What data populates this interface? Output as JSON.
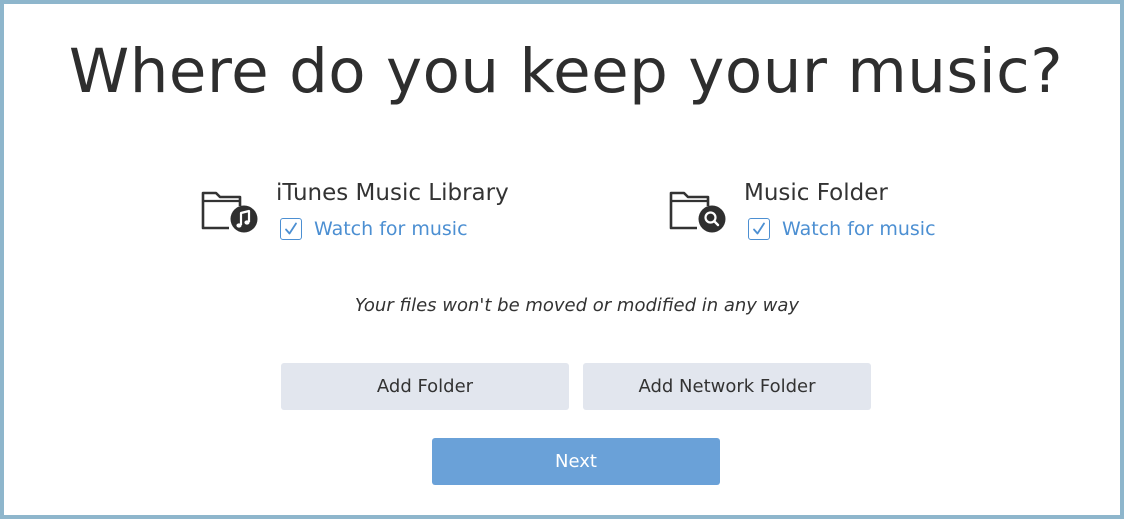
{
  "title": "Where do you keep your music?",
  "sources": [
    {
      "name": "iTunes Music Library",
      "icon": "folder-music-note-icon",
      "watch_label": "Watch for music",
      "watch_checked": true
    },
    {
      "name": "Music Folder",
      "icon": "folder-search-icon",
      "watch_label": "Watch for music",
      "watch_checked": true
    }
  ],
  "note": "Your files won't be moved or modified in any way",
  "buttons": {
    "add_folder": "Add Folder",
    "add_network_folder": "Add Network Folder",
    "next": "Next"
  },
  "colors": {
    "frame_border": "#8eb6cc",
    "accent": "#4c8fd2",
    "secondary_button": "#e2e6ee",
    "primary_button": "#6aa1d8"
  }
}
